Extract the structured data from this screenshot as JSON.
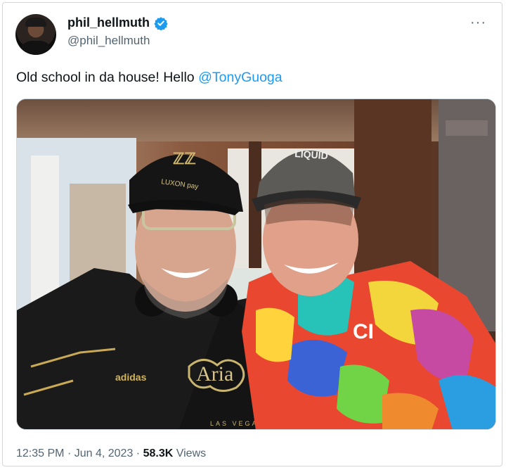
{
  "author": {
    "display_name": "phil_hellmuth",
    "handle": "@phil_hellmuth",
    "verified_icon": "verified-badge-icon",
    "avatar_icon": "avatar-photo"
  },
  "more_icon": "more-options-icon",
  "tweet": {
    "text": "Old school in da house! Hello ",
    "mention": "@TonyGuoga"
  },
  "photo": {
    "cap_left_text": "LUXON pay",
    "cap_right_text": "LIQUID",
    "shirt_text": "Aria",
    "shirt_subtext": "LAS VEGAS",
    "shirt_right_text": "CI"
  },
  "meta": {
    "time": "12:35 PM",
    "separator": "·",
    "date": "Jun 4, 2023",
    "views_count": "58.3K",
    "views_label": "Views"
  },
  "colors": {
    "accent": "#1d9bf0",
    "secondary_text": "#536471"
  }
}
